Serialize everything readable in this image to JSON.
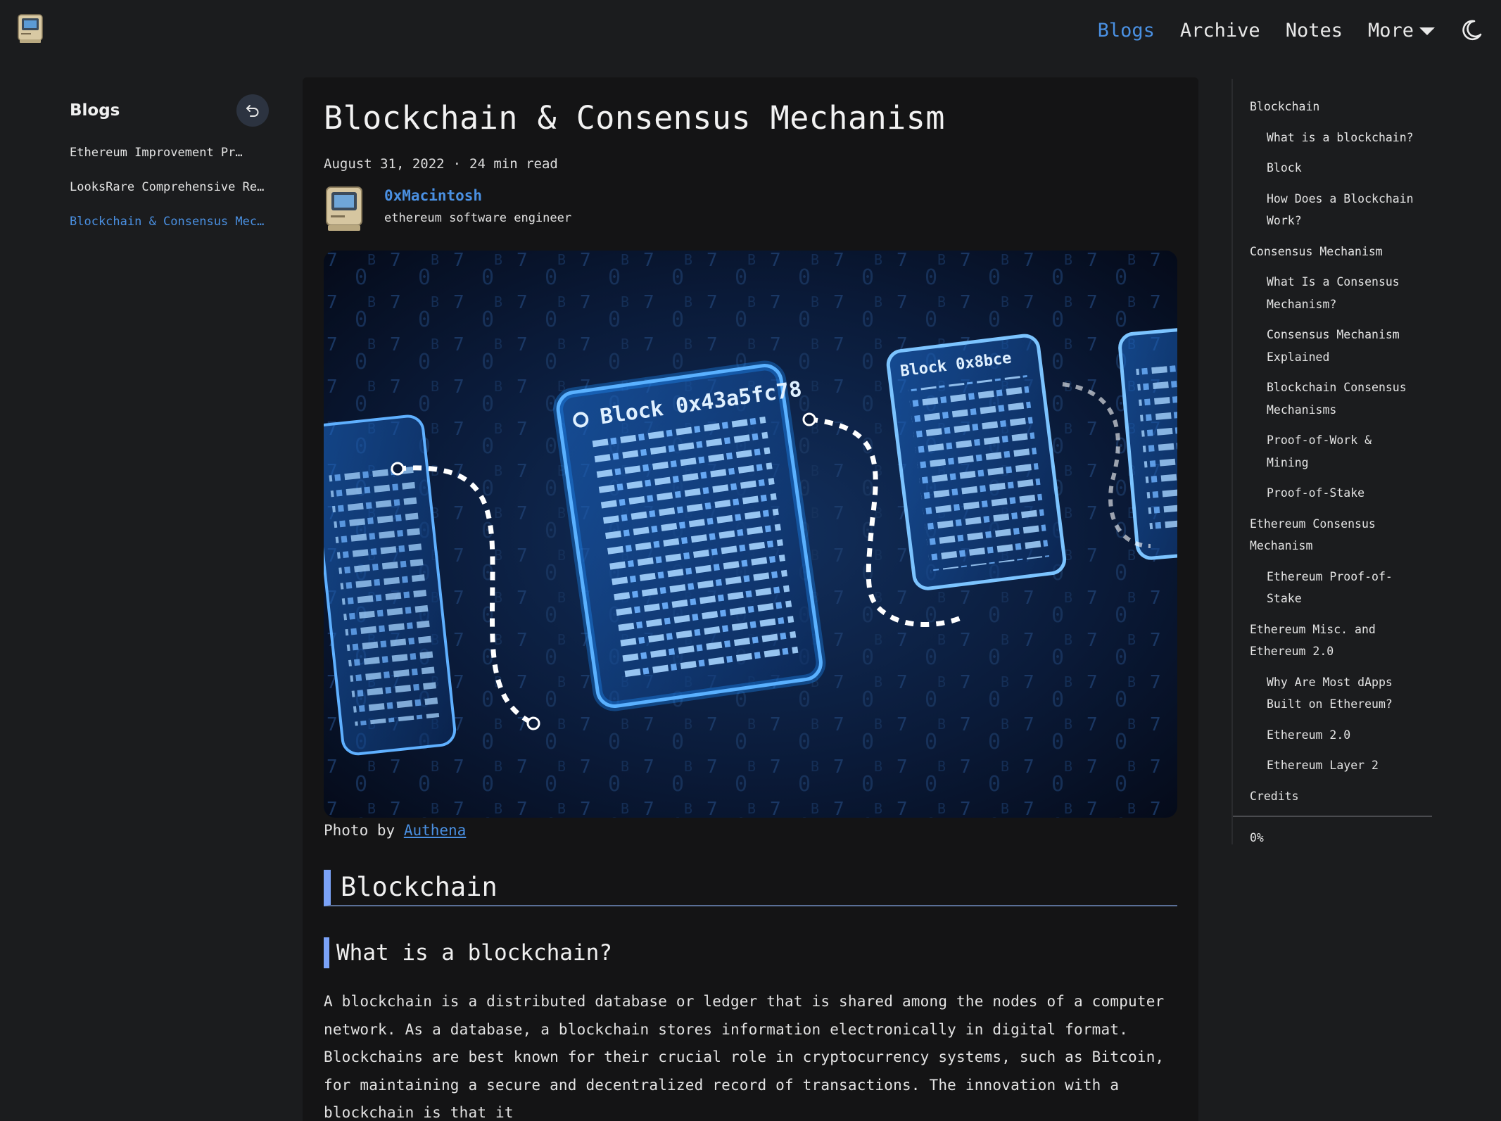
{
  "nav": {
    "links": [
      {
        "label": "Blogs",
        "active": true
      },
      {
        "label": "Archive",
        "active": false
      },
      {
        "label": "Notes",
        "active": false
      }
    ],
    "more_label": "More"
  },
  "sidebar": {
    "title": "Blogs",
    "items": [
      {
        "label": "Ethereum Improvement Pr…",
        "active": false
      },
      {
        "label": "LooksRare Comprehensive Revi…",
        "active": false
      },
      {
        "label": "Blockchain & Consensus Mecha…",
        "active": true
      }
    ]
  },
  "article": {
    "title": "Blockchain & Consensus Mechanism",
    "date": "August 31, 2022",
    "separator": "·",
    "read_time": "24 min read",
    "author": {
      "name": "0xMacintosh",
      "role": "ethereum software engineer"
    },
    "hero_image": {
      "label_main": "Block 0x43a5fc78",
      "label_right": "Block 0x8bce"
    },
    "caption_prefix": "Photo by",
    "caption_link": "Authena",
    "h2": "Blockchain",
    "h3": "What is a blockchain?",
    "paragraph": "A blockchain is a distributed database or ledger that is shared among the nodes of a computer network. As a database, a blockchain stores information electronically in digital format. Blockchains are best known for their crucial role in cryptocurrency systems, such as Bitcoin, for maintaining a secure and decentralized record of transactions. The innovation with a blockchain is that it"
  },
  "toc": {
    "items": [
      {
        "label": "Blockchain",
        "level": 1
      },
      {
        "label": "What is a blockchain?",
        "level": 2
      },
      {
        "label": "Block",
        "level": 2
      },
      {
        "label": "How Does a Blockchain Work?",
        "level": 2
      },
      {
        "label": "Consensus Mechanism",
        "level": 1
      },
      {
        "label": "What Is a Consensus Mechanism?",
        "level": 2
      },
      {
        "label": "Consensus Mechanism Explained",
        "level": 2
      },
      {
        "label": "Blockchain Consensus Mechanisms",
        "level": 2
      },
      {
        "label": "Proof-of-Work & Mining",
        "level": 2
      },
      {
        "label": "Proof-of-Stake",
        "level": 2
      },
      {
        "label": "Ethereum Consensus Mechanism",
        "level": 1
      },
      {
        "label": "Ethereum Proof-of-Stake",
        "level": 2
      },
      {
        "label": "Ethereum Misc. and Ethereum 2.0",
        "level": 1
      },
      {
        "label": "Why Are Most dApps Built on Ethereum?",
        "level": 2
      },
      {
        "label": "Ethereum 2.0",
        "level": 2
      },
      {
        "label": "Ethereum Layer 2",
        "level": 2
      },
      {
        "label": "Credits",
        "level": 1
      }
    ],
    "progress": "0%"
  },
  "colors": {
    "background": "#1b1c1e",
    "card": "#141415",
    "accent": "#4a90e2",
    "heading_bar": "#7aa2f7"
  },
  "icons": {
    "logo": "macintosh-icon",
    "theme": "moon-icon",
    "back": "undo-icon",
    "more": "caret-down-icon"
  }
}
